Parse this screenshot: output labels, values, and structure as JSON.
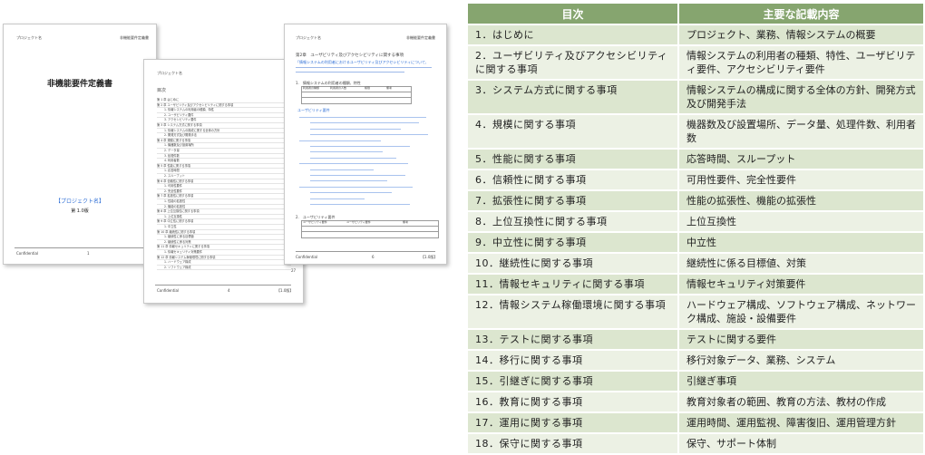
{
  "page1": {
    "header_left": "プロジェクト名",
    "header_right": "非機能要件定義書",
    "title": "非機能要件定義書",
    "project": "【プロジェクト名】",
    "version": "第 1.0版",
    "footer_left": "Confidential",
    "footer_center": "1"
  },
  "page2": {
    "header_left": "プロジェクト名",
    "toc_label": "目次",
    "lines": [
      "第 1 章 はじめに",
      "第 2 章 ユーザビリティ及びアクセシビリティに関する事項",
      "1. 情報システムの利用者の種類、特性",
      "2. ユーザビリティ要件",
      "3. アクセシビリティ要件",
      "第 3 章 システム方式に関する事項",
      "1. 情報システムの構成に関する全体の方針",
      "2. 開発方式及び開発手法",
      "第 4 章 規模に関する事項",
      "1. 機器数及び設置場所",
      "2. データ量",
      "3. 処理件数",
      "4. 利用者数",
      "第 5 章 性能に関する事項",
      "1. 応答時間",
      "2. スループット",
      "第 6 章 信頼性に関する事項",
      "1. 可用性要件",
      "2. 完全性要件",
      "第 7 章 拡張性に関する事項",
      "1. 性能の拡張性",
      "2. 機能の拡張性",
      "第 8 章 上位互換性に関する事項",
      "1. 上位互換性",
      "第 9 章 中立性に関する事項",
      "1. 中立性",
      "第 10 章 継続性に関する事項",
      "1. 継続性に係る目標値",
      "2. 継続性に係る対策",
      "第 11 章 情報セキュリティに関する事項",
      "1. 情報セキュリティ対策要件",
      "第 12 章 情報システム稼働環境に関する事項",
      "1. ハードウェア構成",
      "2. ソフトウェア構成"
    ],
    "footer_left": "Confidential",
    "footer_center": "4",
    "footer_right": "【1.0版】",
    "page_no": "27"
  },
  "page3": {
    "header_left": "プロジェクト名",
    "header_right": "非機能要件定義書",
    "chapter": "第2章　ユーザビリティ及びアクセシビリティに関する事項",
    "intro": "「情報システムの利用者におけるユーザビリティ及びアクセシビリティについて、",
    "section1": "1.　情報システムの利用者の種類、特性",
    "table1_headers": [
      "利用者の種類",
      "利用者の人数",
      "権限",
      "備考"
    ],
    "subsection": "ユーザビリティ要件",
    "section2": "2.　ユーザビリティ要件",
    "table2_headers": [
      "ユーザビリティ要件",
      "ユーザビリティ要件",
      "備考"
    ],
    "footer_left": "Confidential",
    "footer_center": "6",
    "footer_right": "【1.0版】"
  },
  "table": {
    "headers": [
      "目次",
      "主要な記載内容"
    ],
    "rows": [
      [
        "1．はじめに",
        "プロジェクト、業務、情報システムの概要"
      ],
      [
        "2．ユーザビリティ及びアクセシビリティに関する事項",
        "情報システムの利用者の種類、特性、ユーザビリティ要件、アクセシビリティ要件"
      ],
      [
        "3．システム方式に関する事項",
        "情報システムの構成に関する全体の方針、開発方式及び開発手法"
      ],
      [
        "4．規模に関する事項",
        "機器数及び設置場所、データ量、処理件数、利用者数"
      ],
      [
        "5．性能に関する事項",
        "応答時間、スループット"
      ],
      [
        "6．信頼性に関する事項",
        "可用性要件、完全性要件"
      ],
      [
        "7．拡張性に関する事項",
        "性能の拡張性、機能の拡張性"
      ],
      [
        "8．上位互換性に関する事項",
        "上位互換性"
      ],
      [
        "9．中立性に関する事項",
        "中立性"
      ],
      [
        "10．継続性に関する事項",
        "継続性に係る目標値、対策"
      ],
      [
        "11．情報セキュリティに関する事項",
        "情報セキュリティ対策要件"
      ],
      [
        "12．情報システム稼働環境に関する事項",
        "ハードウェア構成、ソフトウェア構成、ネットワーク構成、施設・設備要件"
      ],
      [
        "13．テストに関する事項",
        "テストに関する要件"
      ],
      [
        "14．移行に関する事項",
        "移行対象データ、業務、システム"
      ],
      [
        "15．引継ぎに関する事項",
        "引継ぎ事項"
      ],
      [
        "16．教育に関する事項",
        "教育対象者の範囲、教育の方法、教材の作成"
      ],
      [
        "17．運用に関する事項",
        "運用時間、運用監視、障害復旧、運用管理方針"
      ],
      [
        "18．保守に関する事項",
        "保守、サポート体制"
      ]
    ]
  }
}
